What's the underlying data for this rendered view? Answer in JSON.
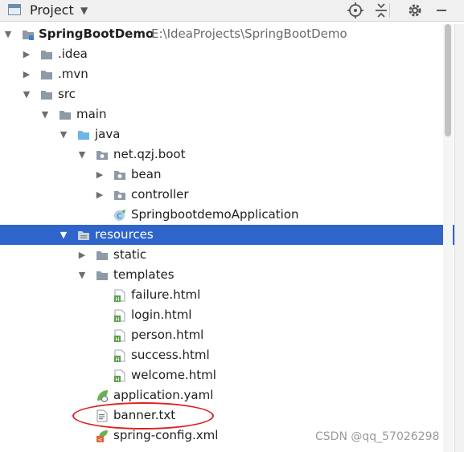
{
  "panel": {
    "title": "Project"
  },
  "project": {
    "name": "SpringBootDemo",
    "path": "E:\\IdeaProjects\\SpringBootDemo"
  },
  "tree": {
    "idea": ".idea",
    "mvn": ".mvn",
    "src": "src",
    "main": "main",
    "java": "java",
    "pkg": "net.qzj.boot",
    "bean": "bean",
    "controller": "controller",
    "app_class": "SpringbootdemoApplication",
    "resources": "resources",
    "static": "static",
    "templates": "templates",
    "files": [
      "failure.html",
      "login.html",
      "person.html",
      "success.html",
      "welcome.html"
    ],
    "application_yaml": "application.yaml",
    "banner": "banner.txt",
    "spring_config": "spring-config.xml"
  },
  "selected_item": "resources",
  "colors": {
    "selection": "#2f65ca",
    "highlight_ellipse": "#e02020",
    "folder": "#8e9aa6",
    "java_folder": "#6bb6e6"
  },
  "watermark": "CSDN @qq_57026298"
}
